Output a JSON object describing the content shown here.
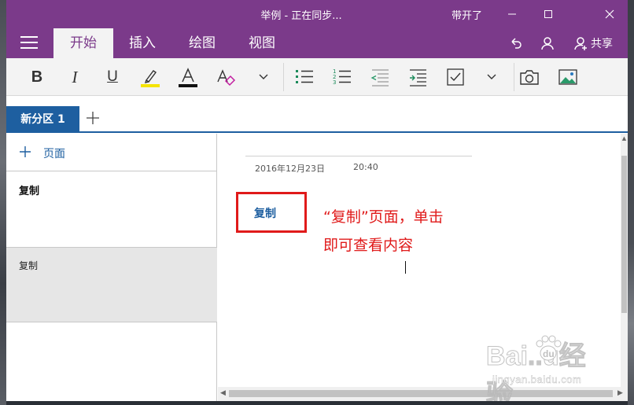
{
  "window": {
    "title": "举例 - 正在同步...",
    "pinned_label": "带开了"
  },
  "ribbon_tabs": [
    "开始",
    "插入",
    "绘图",
    "视图"
  ],
  "share_label": "共享",
  "colors": {
    "brand": "#7b3a8a",
    "section_active": "#1e5fa0",
    "annotation_red": "#e01a1a"
  },
  "toolbar_icons": [
    "bold-icon",
    "italic-icon",
    "underline-icon",
    "highlight-icon",
    "font-color-icon",
    "clear-format-icon",
    "chevron-down-icon",
    "bullets-icon",
    "numbering-icon",
    "decrease-indent-icon",
    "increase-indent-icon",
    "checkbox-icon",
    "chevron-down-icon",
    "camera-icon",
    "picture-icon"
  ],
  "toolbar_letters": {
    "bold": "B",
    "italic": "I",
    "underline": "U",
    "font_color": "A"
  },
  "sections": {
    "active": "新分区 1"
  },
  "pagelist": {
    "add_label": "页面",
    "pages": [
      "复制",
      "复制"
    ]
  },
  "page": {
    "date": "2016年12月23日",
    "time": "20:40",
    "link_text": "复制",
    "annotation_line1": "“复制”页面，单击",
    "annotation_line2": "即可查看内容"
  },
  "watermark": {
    "logo": "Baidu经验",
    "url": "jingyan.baidu.com"
  }
}
